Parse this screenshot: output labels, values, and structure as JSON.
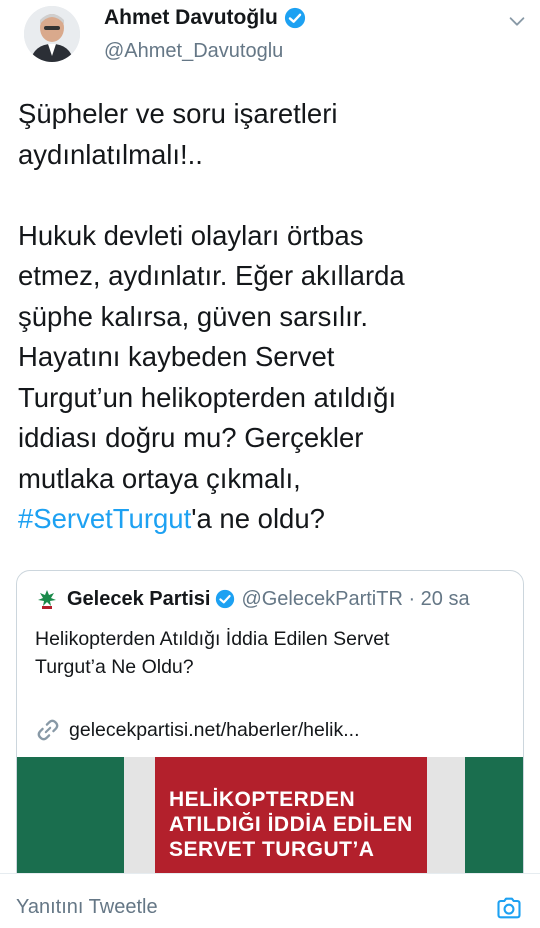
{
  "author": {
    "name": "Ahmet Davutoğlu",
    "handle": "@Ahmet_Davutoglu"
  },
  "tweet": {
    "paragraph1": [
      "Şüpheler ve soru işaretleri",
      "aydınlatılmalı!.."
    ],
    "paragraph2": [
      "Hukuk devleti olayları örtbas",
      "etmez, aydınlatır. Eğer akıllarda",
      "şüphe kalırsa, güven sarsılır.",
      "Hayatını kaybeden Servet",
      "Turgut’un helikopterden atıldığı",
      "iddiası doğru mu? Gerçekler",
      "mutlaka ortaya çıkmalı,"
    ],
    "hashtag": "#ServetTurgut",
    "tail": "'a ne oldu?"
  },
  "quoted": {
    "name": "Gelecek Partisi",
    "handle": "@GelecekPartiTR · 20 sa",
    "text_line1": "Helikopterden Atıldığı İddia Edilen Servet",
    "text_line2": "Turgut’a Ne Oldu?",
    "link": "gelecekpartisi.net/haberler/helik...",
    "media_text": [
      "HELİKOPTERDEN",
      "ATILDIĞI İDDİA EDİLEN",
      "SERVET TURGUT’A"
    ]
  },
  "reply": {
    "placeholder": "Yanıtını Tweetle"
  },
  "icons": {
    "verified": "verified-badge-icon",
    "chevron": "chevron-down-icon",
    "link": "link-icon",
    "camera": "camera-icon"
  },
  "colors": {
    "accent": "#1da1f2",
    "secondary_text": "#657786",
    "party_green": "#1a6e4e",
    "party_red": "#b3202c"
  }
}
